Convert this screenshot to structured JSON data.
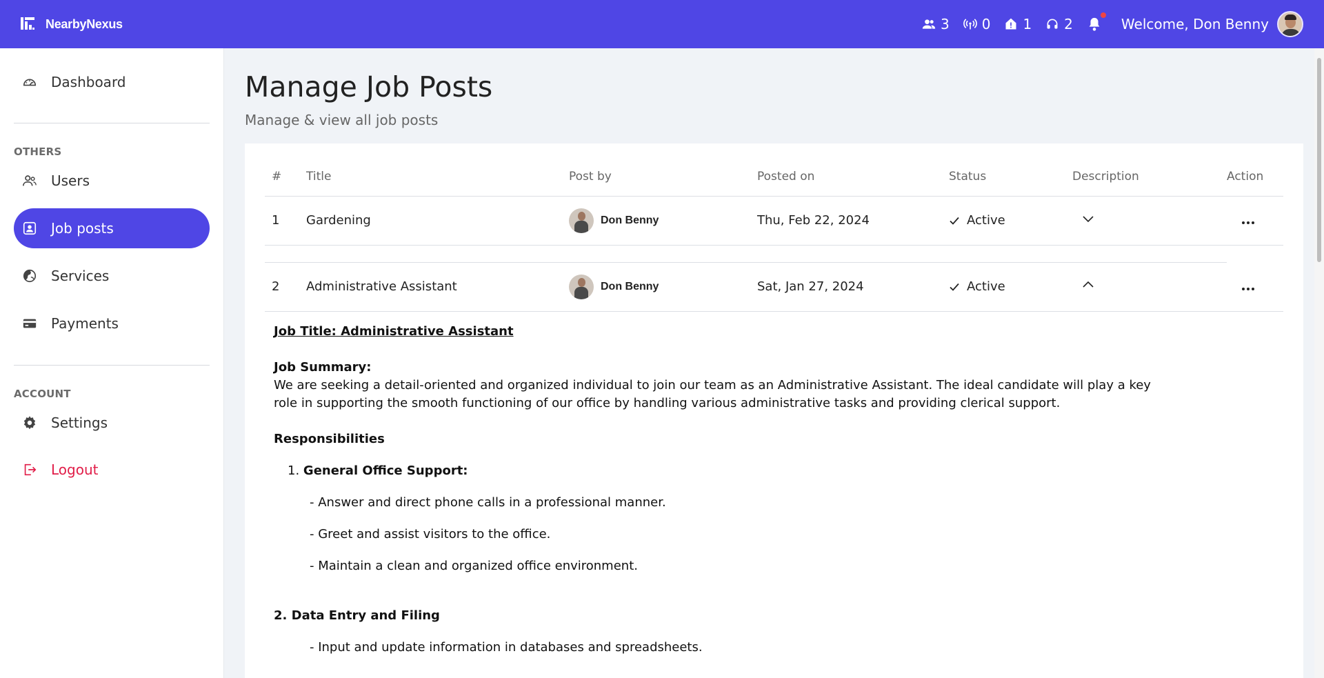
{
  "header": {
    "brand": "NearbyNexus",
    "stats": [
      {
        "icon": "users-icon",
        "value": "3"
      },
      {
        "icon": "broadcast-icon",
        "value": "0"
      },
      {
        "icon": "house-alert-icon",
        "value": "1"
      },
      {
        "icon": "headset-icon",
        "value": "2"
      }
    ],
    "welcome": "Welcome, Don Benny",
    "accent": "#4f46e5",
    "notification_dot": "#ef4444"
  },
  "sidebar": {
    "dashboard": "Dashboard",
    "others_label": "OTHERS",
    "users": "Users",
    "job_posts": "Job posts",
    "services": "Services",
    "payments": "Payments",
    "account_label": "ACCOUNT",
    "settings": "Settings",
    "logout": "Logout"
  },
  "page": {
    "title": "Manage Job Posts",
    "subtitle": "Manage & view all job posts"
  },
  "table": {
    "headers": {
      "num": "#",
      "title": "Title",
      "post_by": "Post by",
      "posted_on": "Posted on",
      "status": "Status",
      "description": "Description",
      "action": "Action"
    },
    "rows": [
      {
        "num": "1",
        "title": "Gardening",
        "post_by": "Don Benny",
        "posted_on": "Thu, Feb 22, 2024",
        "status": "Active",
        "expanded": false
      },
      {
        "num": "2",
        "title": "Administrative Assistant",
        "post_by": "Don Benny",
        "posted_on": "Sat, Jan 27, 2024",
        "status": "Active",
        "expanded": true
      }
    ]
  },
  "description": {
    "job_title": "Job Title: Administrative Assistant",
    "summary_heading": "Job Summary:",
    "summary_text": "We are seeking a detail-oriented and organized individual to join our team as an Administrative Assistant. The ideal candidate will play a key role in supporting the smooth functioning of our office by handling various administrative tasks and providing clerical support.",
    "responsibilities_heading": "Responsibilities",
    "item1_number": "1.",
    "item1_heading": "General Office Support:",
    "item1_bullets": [
      "- Answer and direct phone calls in a professional manner.",
      "- Greet and assist visitors to the office.",
      "- Maintain a clean and organized office environment."
    ],
    "item2_heading": "2. Data Entry and Filing",
    "item2_bullets": [
      "- Input and update information in databases and spreadsheets."
    ]
  }
}
